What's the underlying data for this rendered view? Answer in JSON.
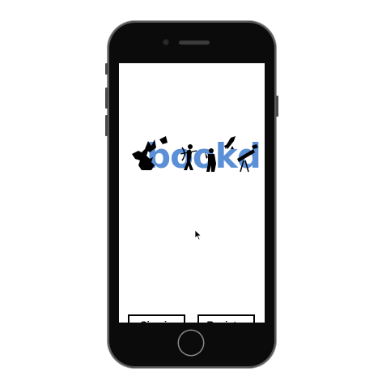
{
  "app": {
    "logo_text": "bookd"
  },
  "actions": {
    "sign_in_label": "Sign in",
    "register_label": "Register"
  },
  "colors": {
    "brand_blue": "#5b8fd6",
    "button_border": "#000000",
    "phone_body": "#0b0b0b"
  },
  "icons": [
    "dragon-icon",
    "knight-icon",
    "archer-icon",
    "explorer-icon",
    "rocket-icon",
    "telescope-icon",
    "mouse-cursor-icon"
  ]
}
